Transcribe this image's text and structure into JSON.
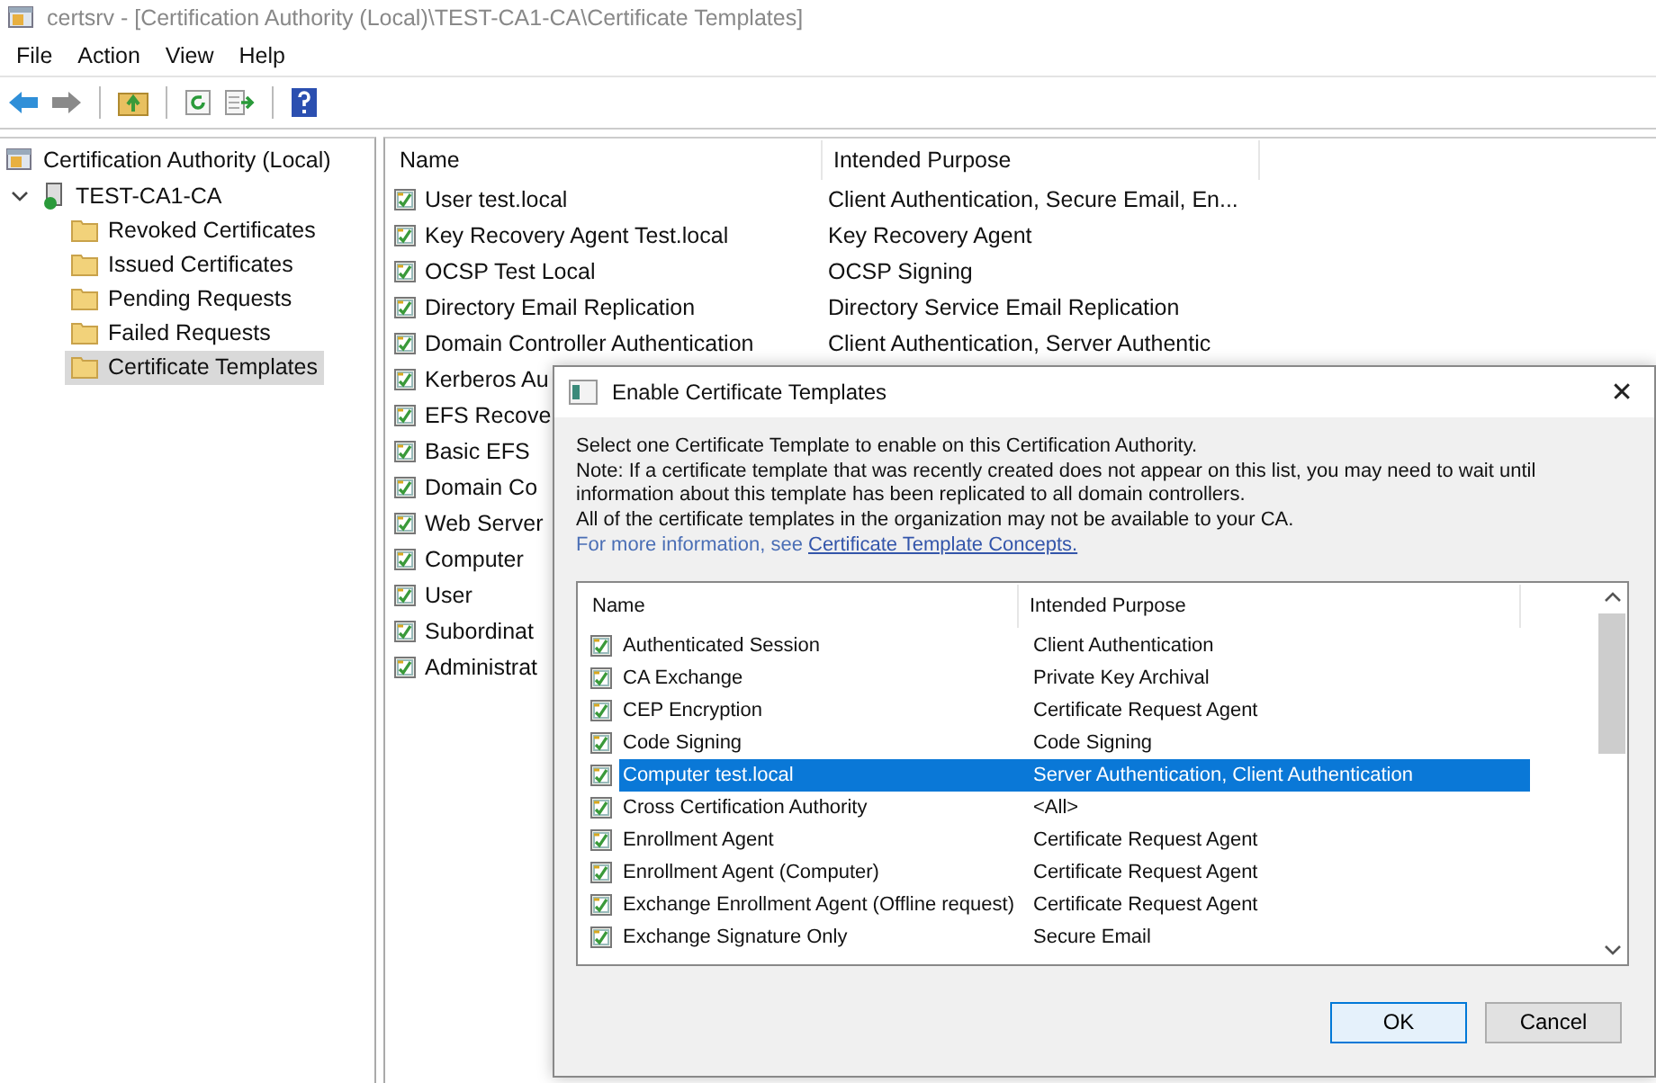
{
  "window": {
    "title": "certsrv - [Certification Authority (Local)\\TEST-CA1-CA\\Certificate Templates]"
  },
  "menu": [
    "File",
    "Action",
    "View",
    "Help"
  ],
  "tree": {
    "label": "Certification Authority (Local)",
    "selected": false,
    "children": [
      {
        "label": "TEST-CA1-CA",
        "selected": false,
        "expanded": true,
        "children": [
          {
            "label": "Revoked Certificates",
            "selected": false
          },
          {
            "label": "Issued Certificates",
            "selected": false
          },
          {
            "label": "Pending Requests",
            "selected": false
          },
          {
            "label": "Failed Requests",
            "selected": false
          },
          {
            "label": "Certificate Templates",
            "selected": true
          }
        ]
      }
    ]
  },
  "list": {
    "columns": [
      "Name",
      "Intended Purpose"
    ],
    "rows": [
      {
        "name": "User test.local",
        "purpose": "Client Authentication, Secure Email, En..."
      },
      {
        "name": "Key Recovery Agent Test.local",
        "purpose": "Key Recovery Agent"
      },
      {
        "name": "OCSP Test Local",
        "purpose": "OCSP Signing"
      },
      {
        "name": "Directory Email Replication",
        "purpose": "Directory Service Email Replication"
      },
      {
        "name": "Domain Controller Authentication",
        "purpose": "Client Authentication, Server Authentic"
      },
      {
        "name": "Kerberos Au"
      },
      {
        "name": "EFS Recove"
      },
      {
        "name": "Basic EFS"
      },
      {
        "name": "Domain Co"
      },
      {
        "name": "Web Server"
      },
      {
        "name": "Computer"
      },
      {
        "name": "User"
      },
      {
        "name": "Subordinat"
      },
      {
        "name": "Administrat"
      }
    ]
  },
  "dialog": {
    "title": "Enable Certificate Templates",
    "close": "✕",
    "lines": [
      "Select one Certificate Template to enable on this Certification Authority.",
      "Note: If a certificate template that was recently created does not appear on this list, you may need to wait until information about this template has been replicated to all domain controllers.",
      "All of the certificate templates in the organization may not be available to your CA."
    ],
    "more_info": "For more information, see",
    "link": "Certificate Template Concepts.",
    "columns": [
      "Name",
      "Intended Purpose"
    ],
    "rows": [
      {
        "name": "Authenticated Session",
        "purpose": "Client Authentication",
        "selected": false
      },
      {
        "name": "CA Exchange",
        "purpose": "Private Key Archival",
        "selected": false
      },
      {
        "name": "CEP Encryption",
        "purpose": "Certificate Request Agent",
        "selected": false
      },
      {
        "name": "Code Signing",
        "purpose": "Code Signing",
        "selected": false
      },
      {
        "name": "Computer test.local",
        "purpose": "Server Authentication, Client Authentication",
        "selected": true
      },
      {
        "name": "Cross Certification Authority",
        "purpose": "<All>",
        "selected": false
      },
      {
        "name": "Enrollment Agent",
        "purpose": "Certificate Request Agent",
        "selected": false
      },
      {
        "name": "Enrollment Agent (Computer)",
        "purpose": "Certificate Request Agent",
        "selected": false
      },
      {
        "name": "Exchange Enrollment Agent (Offline request)",
        "purpose": "Certificate Request Agent",
        "selected": false
      },
      {
        "name": "Exchange Signature Only",
        "purpose": "Secure Email",
        "selected": false
      }
    ],
    "buttons": [
      {
        "label": "OK",
        "focused": true
      },
      {
        "label": "Cancel",
        "focused": false
      }
    ]
  }
}
